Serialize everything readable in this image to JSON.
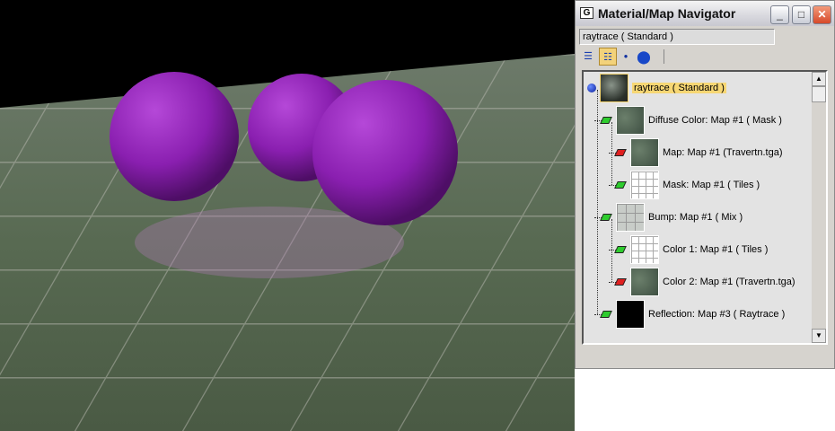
{
  "window": {
    "title": "Material/Map Navigator",
    "minimize": "_",
    "maximize": "□",
    "close": "✕",
    "app_icon": "G"
  },
  "name_field": "raytrace  ( Standard )",
  "toolbar": [
    {
      "name": "view-list-icon",
      "glyph": "☰"
    },
    {
      "name": "view-list-icons-icon",
      "glyph": "☷",
      "selected": true
    },
    {
      "name": "small-sphere-icon",
      "glyph": "●"
    },
    {
      "name": "large-sphere-icon",
      "glyph": "⬤"
    }
  ],
  "tree": [
    {
      "label": "raytrace  ( Standard )",
      "level": 0,
      "type": "root",
      "thumb": "sphere",
      "highlighted": true
    },
    {
      "label": "Diffuse Color: Map #1  ( Mask )",
      "level": 1,
      "icon": "green",
      "thumb": "tex"
    },
    {
      "label": "Map: Map #1 (Travertn.tga)",
      "level": 2,
      "icon": "red",
      "thumb": "tex"
    },
    {
      "label": "Mask: Map #1  ( Tiles )",
      "level": 2,
      "icon": "green",
      "thumb": "tiles"
    },
    {
      "label": "Bump: Map #1  ( Mix )",
      "level": 1,
      "icon": "green",
      "thumb": "mix"
    },
    {
      "label": "Color 1: Map #1  ( Tiles )",
      "level": 2,
      "icon": "green",
      "thumb": "tiles"
    },
    {
      "label": "Color 2: Map #1 (Travertn.tga)",
      "level": 2,
      "icon": "red",
      "thumb": "tex"
    },
    {
      "label": "Reflection: Map #3  ( Raytrace )",
      "level": 1,
      "icon": "green",
      "thumb": "black"
    }
  ],
  "colors": {
    "sphere": "#8a1fb0",
    "floor": "#4c5a45",
    "highlight": "#f7d774"
  }
}
